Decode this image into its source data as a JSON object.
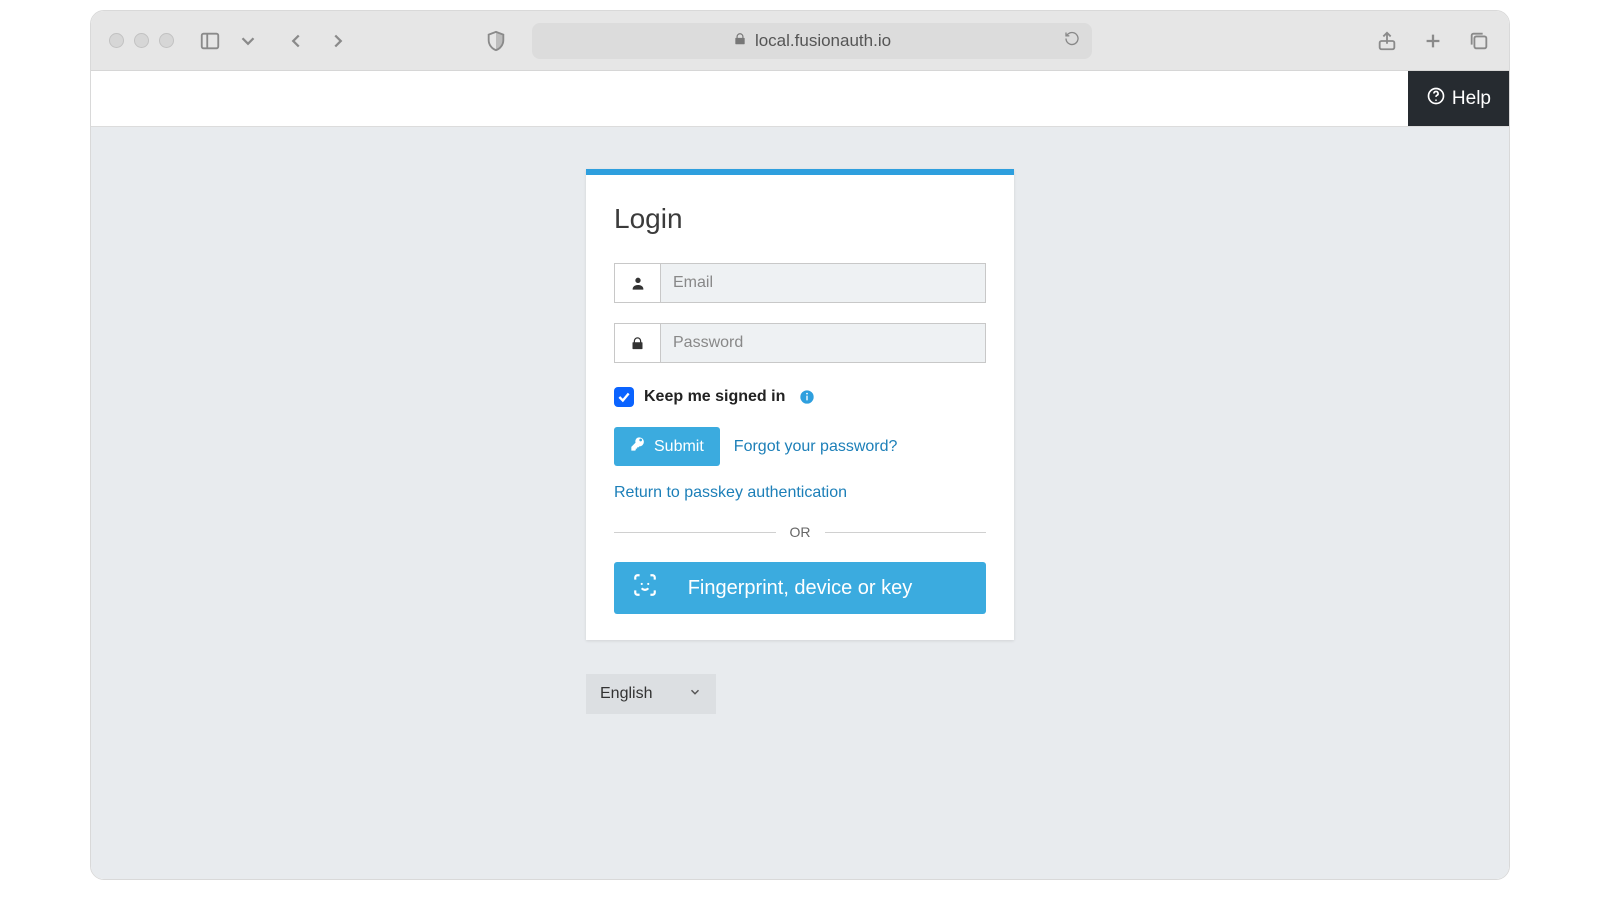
{
  "browser": {
    "url_host": "local.fusionauth.io"
  },
  "header": {
    "help_label": "Help"
  },
  "login": {
    "title": "Login",
    "email_placeholder": "Email",
    "password_placeholder": "Password",
    "keep_signed_in_label": "Keep me signed in",
    "keep_signed_in_checked": true,
    "submit_label": "Submit",
    "forgot_password_label": "Forgot your password?",
    "return_passkey_label": "Return to passkey authentication",
    "or_label": "OR",
    "passkey_button_label": "Fingerprint, device or key"
  },
  "language": {
    "selected": "English"
  }
}
